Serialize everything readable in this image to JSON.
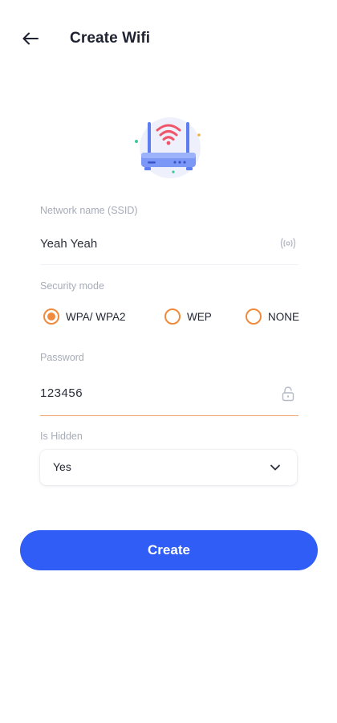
{
  "header": {
    "title": "Create Wifi",
    "back_icon": "arrow-left-icon"
  },
  "illustration": {
    "icon": "wifi-router-icon",
    "colors": {
      "body": "#6d8cf5",
      "waves": "#f0566a",
      "background": "#eef1fb"
    }
  },
  "form": {
    "ssid": {
      "label": "Network name (SSID)",
      "value": "Yeah Yeah",
      "icon": "signal-broadcast-icon"
    },
    "security": {
      "label": "Security mode",
      "options": [
        {
          "label": "WPA/ WPA2",
          "selected": true
        },
        {
          "label": "WEP",
          "selected": false
        },
        {
          "label": "NONE",
          "selected": false
        }
      ]
    },
    "password": {
      "label": "Password",
      "value": "123456",
      "icon": "lock-icon"
    },
    "hidden": {
      "label": "Is Hidden",
      "value": "Yes",
      "icon": "chevron-down-icon"
    }
  },
  "actions": {
    "create_label": "Create"
  },
  "colors": {
    "accent": "#f08a3c",
    "primary_button": "#2f5df5",
    "label": "#a6acb8",
    "text": "#232733"
  }
}
